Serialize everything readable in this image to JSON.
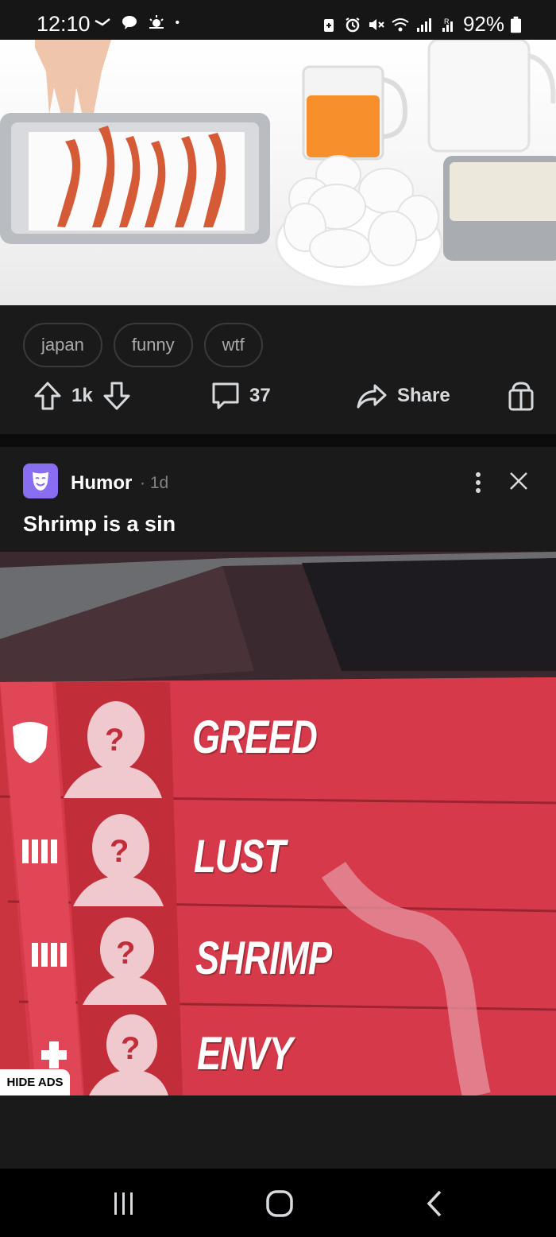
{
  "status_bar": {
    "time": "12:10",
    "battery": "92%",
    "icons": [
      "missed-call-icon",
      "chat-icon",
      "weather-icon",
      "dot-icon",
      "battery-saver-icon",
      "alarm-icon",
      "mute-icon",
      "wifi-icon",
      "signal-icon",
      "roaming-signal-icon",
      "battery-icon"
    ]
  },
  "post1": {
    "tags": [
      "japan",
      "funny",
      "wtf"
    ],
    "upvotes": "1k",
    "comments": "37",
    "share_label": "Share"
  },
  "post2": {
    "subreddit": "Humor",
    "age": "1d",
    "title": "Shrimp is a sin",
    "meme_rows": [
      "GREED",
      "LUST",
      "SHRIMP",
      "ENVY"
    ]
  },
  "hide_ads_label": "HIDE ADS",
  "colors": {
    "background": "#1a1a1b",
    "subreddit_icon": "#8a6ef2",
    "meme_red": "#d63a4a"
  }
}
